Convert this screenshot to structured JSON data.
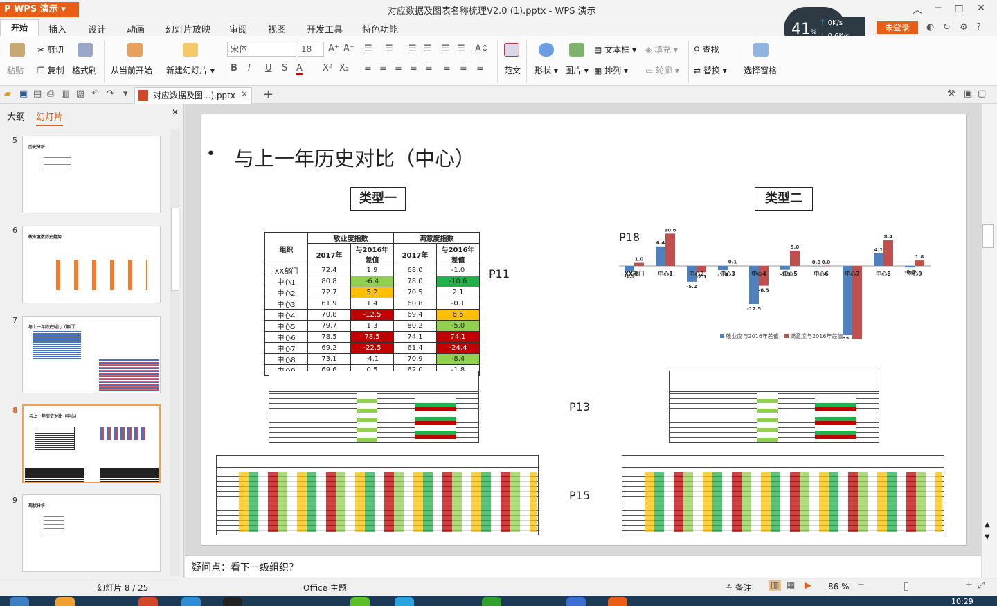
{
  "app": {
    "name": "WPS 演示",
    "doc_title": "对应数据及图表名称梳理V2.0 (1).pptx - WPS 演示"
  },
  "window": {
    "min": "︿",
    "restore": "─",
    "max": "□",
    "close": "✕"
  },
  "menu": [
    "开始",
    "插入",
    "设计",
    "动画",
    "幻灯片放映",
    "审阅",
    "视图",
    "开发工具",
    "特色功能"
  ],
  "login": "未登录",
  "speed": {
    "percent": "41",
    "unit": "%",
    "up": "0K/s",
    "down": "0.6K/s"
  },
  "ribbon": {
    "paste": "粘贴",
    "cut": "剪切",
    "copy": "复制",
    "format_painter": "格式刷",
    "from_current": "从当前开始",
    "new_slide": "新建幻灯片",
    "font": "宋体",
    "font_size": "18",
    "sample": "范文",
    "shape": "形状",
    "picture": "图片",
    "textbox": "文本框",
    "fill": "填充",
    "arrange": "排列",
    "outline": "轮廓",
    "find": "查找",
    "replace": "替换",
    "selection_pane": "选择窗格"
  },
  "doc_tab": "对应数据及图...).pptx",
  "panel": {
    "tab_outline": "大纲",
    "tab_slides": "幻灯片"
  },
  "thumbs": [
    {
      "num": "5",
      "title": "历史分析"
    },
    {
      "num": "6",
      "title": "敬业度数历史趋势"
    },
    {
      "num": "7",
      "title": "与上一年历史对比（部门）"
    },
    {
      "num": "8",
      "title": "与上一年历史对比（中心）"
    },
    {
      "num": "9",
      "title": "现状分析"
    }
  ],
  "slide": {
    "heading": "与上一年历史对比（中心）",
    "type1": "类型一",
    "type2": "类型二",
    "labels": {
      "p11": "P11",
      "p18": "P18",
      "p13": "P13",
      "p15": "P15"
    },
    "table": {
      "h_org": "组织",
      "h_eng": "敬业度指数",
      "h_sat": "满意度指数",
      "h_2017": "2017年",
      "h_diff": "与2016年差值",
      "rows": [
        [
          "XX部门",
          "72.4",
          "1.9",
          "68.0",
          "-1.0"
        ],
        [
          "中心1",
          "80.8",
          "-6.4",
          "78.0",
          "-10.6"
        ],
        [
          "中心2",
          "72.7",
          "5.2",
          "70.5",
          "2.1"
        ],
        [
          "中心3",
          "61.9",
          "1.4",
          "60.8",
          "-0.1"
        ],
        [
          "中心4",
          "70.8",
          "-12.5",
          "69.4",
          "6.5"
        ],
        [
          "中心5",
          "79.7",
          "1.3",
          "80.2",
          "-5.0"
        ],
        [
          "中心6",
          "78.5",
          "78.5",
          "74.1",
          "74.1"
        ],
        [
          "中心7",
          "69.2",
          "-22.5",
          "61.4",
          "-24.4"
        ],
        [
          "中心8",
          "73.1",
          "-4.1",
          "70.9",
          "-8.4"
        ],
        [
          "中心9",
          "69.6",
          "0.5",
          "62.0",
          "-1.8"
        ]
      ]
    },
    "legend": {
      "s1": "敬业度与2016年差值",
      "s2": "满意度与2016年差值"
    }
  },
  "chart_data": {
    "type": "bar",
    "categories": [
      "XX部门",
      "中心1",
      "中心2",
      "中心3",
      "中心4",
      "中心5",
      "中心6",
      "中心7",
      "中心8",
      "中心9"
    ],
    "series": [
      {
        "name": "敬业度与2016年差值",
        "values": [
          -1.9,
          6.4,
          -5.2,
          -1.4,
          -12.5,
          -1.3,
          0.0,
          -22.5,
          4.1,
          -0.5
        ],
        "color": "#4f81bd"
      },
      {
        "name": "满意度与2016年差值",
        "values": [
          1.0,
          10.6,
          -2.1,
          0.1,
          -6.5,
          5.0,
          0.0,
          -24.4,
          8.4,
          1.8
        ],
        "color": "#c0504d"
      }
    ]
  },
  "notes": "疑问点：看下一级组织？",
  "status": {
    "slide": "幻灯片 8 / 25",
    "theme": "Office 主题",
    "notes_btn": "备注",
    "zoom": "86 %",
    "time": "10:29"
  }
}
